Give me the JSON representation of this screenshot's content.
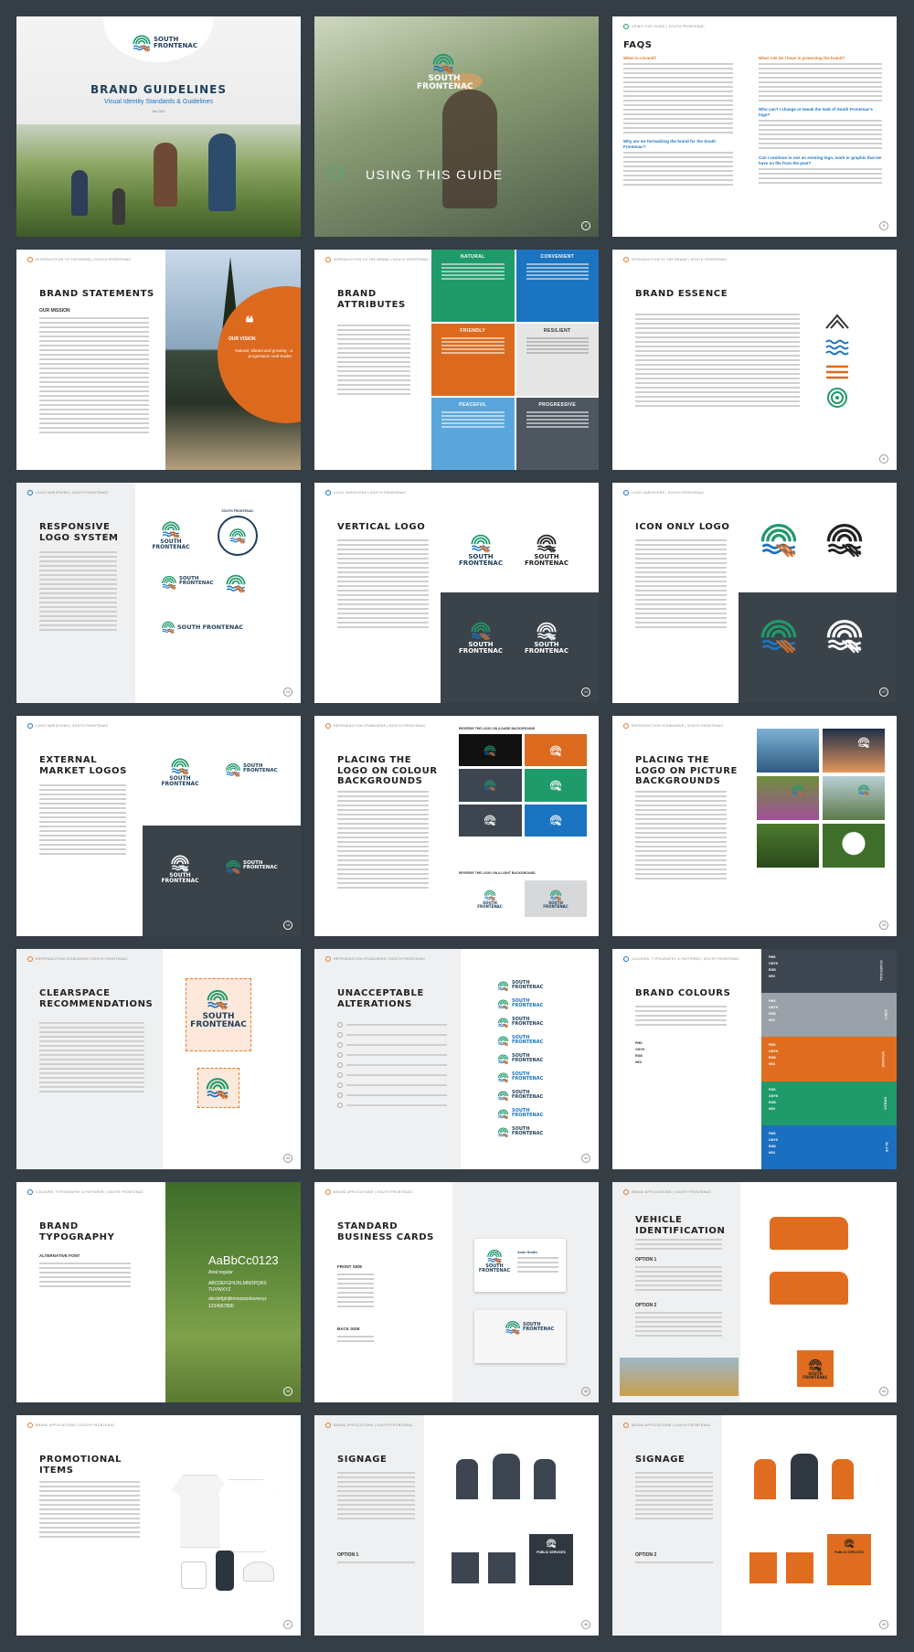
{
  "p1": {
    "logo": "SOUTH\nFRONTENAC",
    "title": "BRAND GUIDELINES",
    "subtitle": "Visual Identity Standards & Guidelines",
    "date": "Jan 2021"
  },
  "p2": {
    "logo": "SOUTH\nFRONTENAC",
    "num": "1",
    "title": "USING THIS GUIDE",
    "page": "5"
  },
  "p3": {
    "header": "USING THIS GUIDE | SOUTH FRONTENAC",
    "title": "FAQS",
    "q1": "What is a brand?",
    "q2": "Why are we formalizing the brand for the South Frontenac?",
    "q3": "What role do I have in protecting the brand?",
    "q4": "Who can't I change or tweak the look of South Frontenac's logo?",
    "q5": "Can I continue to use an existing logo, mark or graphic that we have on file from the past?",
    "page": "6"
  },
  "p4": {
    "header": "INTRODUCTION TO THE BRAND | SOUTH FRONTENAC",
    "title": "BRAND STATEMENTS",
    "mission": "OUR MISSION",
    "vision": "OUR VISION",
    "vision_text": "Natural, vibrant and growing - a progressive rural leader.",
    "page": "7"
  },
  "p5": {
    "header": "INTRODUCTION TO THE BRAND | SOUTH FRONTENAC",
    "title": "BRAND\nATTRIBUTES",
    "attrs": [
      {
        "name": "NATURAL",
        "color": "#1f9a6b"
      },
      {
        "name": "CONVENIENT",
        "color": "#1b74c1"
      },
      {
        "name": "FRIENDLY",
        "color": "#dc6a1e"
      },
      {
        "name": "RESILIENT",
        "color": "#e6e6e6"
      },
      {
        "name": "PEACEFUL",
        "color": "#5aa6dc"
      },
      {
        "name": "PROGRESSIVE",
        "color": "#4e5660"
      }
    ]
  },
  "p6": {
    "header": "INTRODUCTION TO THE BRAND | SOUTH FRONTENAC",
    "title": "BRAND ESSENCE",
    "page": "11"
  },
  "p7": {
    "header": "LOGO VARIATIONS | SOUTH FRONTENAC",
    "title": "RESPONSIVE\nLOGO SYSTEM",
    "logo": "SOUTH\nFRONTENAC",
    "logo_h": "SOUTH\nFRONTENAC",
    "logo_long": "SOUTH FRONTENAC",
    "seal": "SOUTH FRONTENAC",
    "page": "13"
  },
  "p8": {
    "header": "LOGO VARIATIONS | SOUTH FRONTENAC",
    "title": "VERTICAL LOGO",
    "logo": "SOUTH\nFRONTENAC",
    "page": "14"
  },
  "p9": {
    "header": "LOGO VARIATIONS | SOUTH FRONTENAC",
    "title": "ICON ONLY LOGO",
    "page": "17"
  },
  "p10": {
    "header": "LOGO VARIATIONS | SOUTH FRONTENAC",
    "title": "EXTERNAL\nMARKET LOGOS",
    "logo": "SOUTH\nFRONTENAC",
    "page": "18"
  },
  "p11": {
    "header": "REPRODUCTION STANDARDS | SOUTH FRONTENAC",
    "title": "PLACING THE\nLOGO ON COLOUR\nBACKGROUNDS",
    "dark_label": "REVERSE THE LOGO ON A DARK BACKGROUND",
    "light_label": "REVERSE THE LOGO ON A LIGHT BACKGROUND",
    "logo": "SOUTH\nFRONTENAC"
  },
  "p12": {
    "header": "REPRODUCTION STANDARDS | SOUTH FRONTENAC",
    "title": "PLACING THE\nLOGO ON PICTURE\nBACKGROUNDS",
    "logo": "SOUTH\nFRONTENAC",
    "page": "33"
  },
  "p13": {
    "header": "REPRODUCTION STANDARDS | SOUTH FRONTENAC",
    "title": "CLEARSPACE\nRECOMMENDATIONS",
    "logo": "SOUTH\nFRONTENAC",
    "page": "33"
  },
  "p14": {
    "header": "REPRODUCTION STANDARDS | SOUTH FRONTENAC",
    "title": "UNACCEPTABLE\nALTERATIONS",
    "logo": "SOUTH\nFRONTENAC",
    "page": "34"
  },
  "p15": {
    "header": "COLOURS, TYPOGRAPHY & PATTERNS | SOUTH FRONTENAC",
    "title": "BRAND COLOURS",
    "labels": [
      "PMS",
      "CMYK",
      "RGB",
      "HEX"
    ],
    "page": "37",
    "swatches": [
      {
        "name": "CHARCOAL",
        "color": "#3d4650"
      },
      {
        "name": "GREY",
        "color": "#9aa1a8"
      },
      {
        "name": "ORANGE",
        "color": "#e06d1f"
      },
      {
        "name": "GREEN",
        "color": "#1f9a6b"
      },
      {
        "name": "BLUE",
        "color": "#1b6fc0"
      }
    ]
  },
  "p16": {
    "header": "COLOURS, TYPOGRAPHY & PATTERNS | SOUTH FRONTENAC",
    "title": "BRAND\nTYPOGRAPHY",
    "alt": "ALTERNATIVE FONT",
    "sample": "AaBbCc0123",
    "font": "Arial regular",
    "upper": "ABCDEFGHIJKLMNOPQRS\nTUVWXYZ",
    "lower": "abcdefghijklmnopqrstuvwxyz",
    "digits": "1234567890",
    "page": "38"
  },
  "p17": {
    "header": "BRAND APPLICATIONS | SOUTH FRONTENAC",
    "title": "STANDARD\nBUSINESS CARDS",
    "front": "FRONT SIDE",
    "back": "BACK SIDE",
    "logo": "SOUTH\nFRONTENAC",
    "name": "John Smith",
    "page": "43"
  },
  "p18": {
    "header": "BRAND APPLICATIONS | SOUTH FRONTENAC",
    "title": "VEHICLE\nIDENTIFICATION",
    "opt1": "OPTION 1",
    "opt2": "OPTION 2",
    "logo": "SOUTH\nFRONTENAC",
    "page": "44"
  },
  "p19": {
    "header": "BRAND APPLICATIONS | SOUTH FRONTENAC",
    "title": "PROMOTIONAL\nITEMS",
    "page": "47"
  },
  "p20": {
    "header": "BRAND APPLICATIONS | SOUTH FRONTENAC",
    "title": "SIGNAGE",
    "opt": "OPTION 1",
    "ps": "PUBLIC SERVICES",
    "page": "48"
  },
  "p21": {
    "header": "BRAND APPLICATIONS | SOUTH FRONTENAC",
    "title": "SIGNAGE",
    "opt": "OPTION 2",
    "ps": "PUBLIC SERVICES",
    "page": "49"
  }
}
